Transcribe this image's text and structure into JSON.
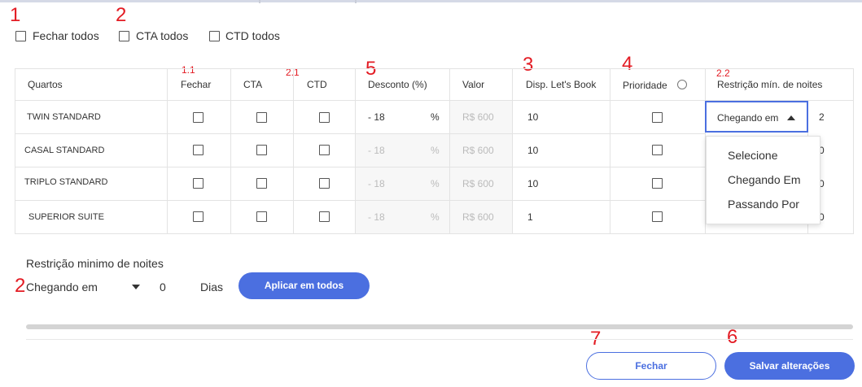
{
  "annotations": {
    "n1": "1",
    "n2_top": "2",
    "n1_1": "1.1",
    "n2_1": "2.1",
    "n5": "5",
    "n3": "3",
    "n4": "4",
    "n2_2": "2.2",
    "n2_bottom": "2",
    "n7": "7",
    "n6": "6"
  },
  "bulk": {
    "fechar_todos": "Fechar todos",
    "cta_todos": "CTA todos",
    "ctd_todos": "CTD todos"
  },
  "table": {
    "headers": {
      "quartos": "Quartos",
      "fechar": "Fechar",
      "cta": "CTA",
      "ctd": "CTD",
      "desconto": "Desconto (%)",
      "valor": "Valor",
      "disp": "Disp. Let's Book",
      "prioridade": "Prioridade",
      "restricao": "Restrição mín. de noites"
    },
    "percent_sign": "%",
    "info_glyph": "i",
    "rows": [
      {
        "name": "TWIN STANDARD",
        "discount": "- 18",
        "price": "R$ 600",
        "disp": "10",
        "nights": "2"
      },
      {
        "name": "CASAL STANDARD",
        "discount": "- 18",
        "price": "R$ 600",
        "disp": "10",
        "nights": "0"
      },
      {
        "name": "TRIPLO STANDARD",
        "discount": "- 18",
        "price": "R$ 600",
        "disp": "10",
        "nights": "0"
      },
      {
        "name": "SUPERIOR SUITE",
        "discount": "- 18",
        "price": "R$ 600",
        "disp": "1",
        "nights": "0"
      }
    ],
    "restriction_select_value": "Chegando em",
    "restriction_options": [
      "Selecione",
      "Chegando Em",
      "Passando Por"
    ]
  },
  "bottom": {
    "title": "Restrição minimo de noites",
    "select_value": "Chegando em",
    "days_value": "0",
    "days_label": "Dias",
    "apply_button": "Aplicar em todos"
  },
  "footer": {
    "close_button": "Fechar",
    "save_button": "Salvar alterações"
  },
  "colors": {
    "primary": "#4b6fe0",
    "annotation_red": "#e31b23"
  }
}
